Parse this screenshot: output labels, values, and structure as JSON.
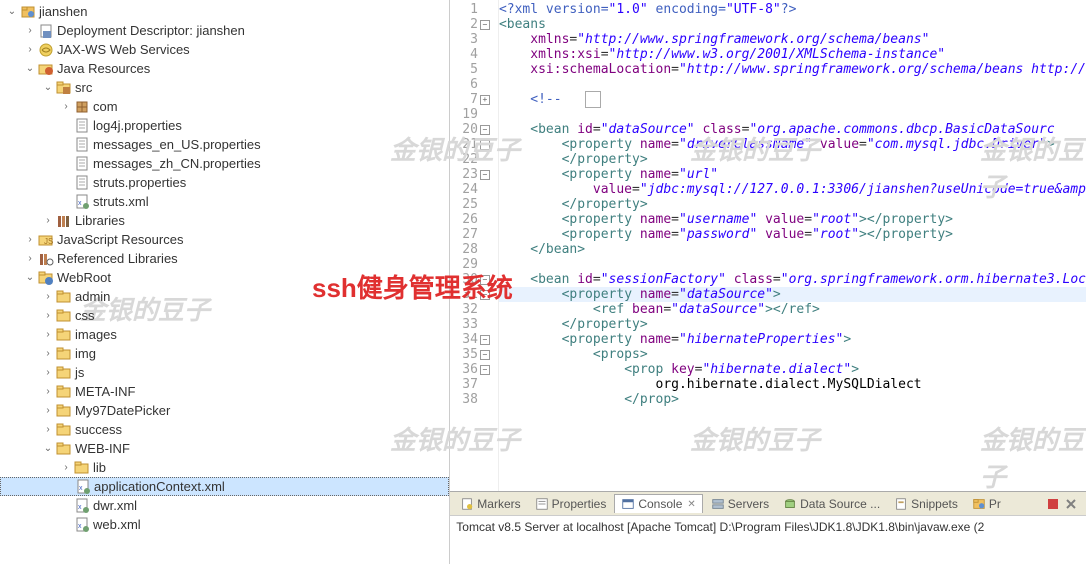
{
  "overlay_title": "ssh健身管理系统",
  "watermarks": [
    "金银的豆子",
    "金银的豆子",
    "金银的豆子",
    "金银的豆子",
    "金银的豆子",
    "金银的豆子",
    "金银的豆子"
  ],
  "tree": [
    {
      "depth": 0,
      "twisty": "down",
      "icon": "project",
      "label": "jianshen"
    },
    {
      "depth": 1,
      "twisty": "right",
      "icon": "dd",
      "label": "Deployment Descriptor: jianshen"
    },
    {
      "depth": 1,
      "twisty": "right",
      "icon": "jaxws",
      "label": "JAX-WS Web Services"
    },
    {
      "depth": 1,
      "twisty": "down",
      "icon": "javares",
      "label": "Java Resources"
    },
    {
      "depth": 2,
      "twisty": "down",
      "icon": "srcfolder",
      "label": "src"
    },
    {
      "depth": 3,
      "twisty": "right",
      "icon": "package",
      "label": "com"
    },
    {
      "depth": 3,
      "twisty": "",
      "icon": "file",
      "label": "log4j.properties"
    },
    {
      "depth": 3,
      "twisty": "",
      "icon": "file",
      "label": "messages_en_US.properties"
    },
    {
      "depth": 3,
      "twisty": "",
      "icon": "file",
      "label": "messages_zh_CN.properties"
    },
    {
      "depth": 3,
      "twisty": "",
      "icon": "file",
      "label": "struts.properties"
    },
    {
      "depth": 3,
      "twisty": "",
      "icon": "xml",
      "label": "struts.xml"
    },
    {
      "depth": 2,
      "twisty": "right",
      "icon": "lib",
      "label": "Libraries"
    },
    {
      "depth": 1,
      "twisty": "right",
      "icon": "jsres",
      "label": "JavaScript Resources"
    },
    {
      "depth": 1,
      "twisty": "right",
      "icon": "reflib",
      "label": "Referenced Libraries"
    },
    {
      "depth": 1,
      "twisty": "down",
      "icon": "webfolder",
      "label": "WebRoot"
    },
    {
      "depth": 2,
      "twisty": "right",
      "icon": "folder",
      "label": "admin"
    },
    {
      "depth": 2,
      "twisty": "right",
      "icon": "folder",
      "label": "css"
    },
    {
      "depth": 2,
      "twisty": "right",
      "icon": "folder",
      "label": "images"
    },
    {
      "depth": 2,
      "twisty": "right",
      "icon": "folder",
      "label": "img"
    },
    {
      "depth": 2,
      "twisty": "right",
      "icon": "folder",
      "label": "js"
    },
    {
      "depth": 2,
      "twisty": "right",
      "icon": "folder",
      "label": "META-INF"
    },
    {
      "depth": 2,
      "twisty": "right",
      "icon": "folder",
      "label": "My97DatePicker"
    },
    {
      "depth": 2,
      "twisty": "right",
      "icon": "folder",
      "label": "success"
    },
    {
      "depth": 2,
      "twisty": "down",
      "icon": "folder",
      "label": "WEB-INF"
    },
    {
      "depth": 3,
      "twisty": "right",
      "icon": "folder",
      "label": "lib"
    },
    {
      "depth": 3,
      "twisty": "",
      "icon": "xml",
      "label": "applicationContext.xml",
      "selected": true
    },
    {
      "depth": 3,
      "twisty": "",
      "icon": "xml",
      "label": "dwr.xml"
    },
    {
      "depth": 3,
      "twisty": "",
      "icon": "xml",
      "label": "web.xml"
    }
  ],
  "code": {
    "lines": [
      {
        "n": 1,
        "fold": "",
        "html": "<span class='c-comment'>&lt;?xml version=</span><span class='c-str'>\"1.0\"</span><span class='c-comment'> encoding=</span><span class='c-str'>\"UTF-8\"</span><span class='c-comment'>?&gt;</span>"
      },
      {
        "n": 2,
        "fold": "-",
        "html": "<span class='c-tag'>&lt;beans</span>"
      },
      {
        "n": 3,
        "fold": "",
        "html": "    <span class='c-attr'>xmlns</span>=<span class='c-val'>\"http://www.springframework.org/schema/beans\"</span>"
      },
      {
        "n": 4,
        "fold": "",
        "html": "    <span class='c-attr'>xmlns:xsi</span>=<span class='c-val'>\"http://www.w3.org/2001/XMLSchema-instance\"</span>"
      },
      {
        "n": 5,
        "fold": "",
        "html": "    <span class='c-attr'>xsi:schemaLocation</span>=<span class='c-val'>\"http://www.springframework.org/schema/beans http://</span>"
      },
      {
        "n": 6,
        "fold": "",
        "html": ""
      },
      {
        "n": 7,
        "fold": "+",
        "html": "    <span class='c-comment'>&lt;!--</span>   <span style='border:1px solid #aaa;padding:0 3px;'>&nbsp;</span>"
      },
      {
        "n": 19,
        "fold": "",
        "html": ""
      },
      {
        "n": 20,
        "fold": "-",
        "html": "    <span class='c-tag'>&lt;bean</span> <span class='c-attr'>id</span>=<span class='c-val'>\"dataSource\"</span> <span class='c-attr'>class</span>=<span class='c-val'>\"org.apache.commons.dbcp.BasicDataSourc</span>"
      },
      {
        "n": 21,
        "fold": "-",
        "html": "        <span class='c-tag'>&lt;property</span> <span class='c-attr'>name</span>=<span class='c-val'>\"driverClassName\"</span> <span class='c-attr'>value</span>=<span class='c-val'>\"com.mysql.jdbc.Driver\"</span><span class='c-tag'>&gt;</span>"
      },
      {
        "n": 22,
        "fold": "",
        "html": "        <span class='c-tag'>&lt;/property&gt;</span>"
      },
      {
        "n": 23,
        "fold": "-",
        "html": "        <span class='c-tag'>&lt;property</span> <span class='c-attr'>name</span>=<span class='c-val'>\"url\"</span>"
      },
      {
        "n": 24,
        "fold": "",
        "html": "            <span class='c-attr'>value</span>=<span class='c-val'>\"jdbc:mysql://127.0.0.1:3306/jianshen?useUnicode=true&amp;amp</span>"
      },
      {
        "n": 25,
        "fold": "",
        "html": "        <span class='c-tag'>&lt;/property&gt;</span>"
      },
      {
        "n": 26,
        "fold": "",
        "html": "        <span class='c-tag'>&lt;property</span> <span class='c-attr'>name</span>=<span class='c-val'>\"username\"</span> <span class='c-attr'>value</span>=<span class='c-val'>\"root\"</span><span class='c-tag'>&gt;&lt;/property&gt;</span>"
      },
      {
        "n": 27,
        "fold": "",
        "html": "        <span class='c-tag'>&lt;property</span> <span class='c-attr'>name</span>=<span class='c-val'>\"password\"</span> <span class='c-attr'>value</span>=<span class='c-val'>\"root\"</span><span class='c-tag'>&gt;&lt;/property&gt;</span>"
      },
      {
        "n": 28,
        "fold": "",
        "html": "    <span class='c-tag'>&lt;/bean&gt;</span>"
      },
      {
        "n": 29,
        "fold": "",
        "html": ""
      },
      {
        "n": 30,
        "fold": "-",
        "html": "    <span class='c-tag'>&lt;bean</span> <span class='c-attr'>id</span>=<span class='c-val'>\"sessionFactory\"</span> <span class='c-attr'>class</span>=<span class='c-val'>\"org.springframework.orm.hibernate3.Loc</span>"
      },
      {
        "n": 31,
        "fold": "-",
        "hl": true,
        "html": "        <span class='c-tag'>&lt;property</span> <span class='c-attr'>name</span>=<span class='c-val'>\"dataSource\"</span><span class='c-tag'>&gt;</span>"
      },
      {
        "n": 32,
        "fold": "",
        "html": "            <span class='c-tag'>&lt;ref</span> <span class='c-attr'>bean</span>=<span class='c-val'>\"dataSource\"</span><span class='c-tag'>&gt;&lt;/ref&gt;</span>"
      },
      {
        "n": 33,
        "fold": "",
        "html": "        <span class='c-tag'>&lt;/property&gt;</span>"
      },
      {
        "n": 34,
        "fold": "-",
        "html": "        <span class='c-tag'>&lt;property</span> <span class='c-attr'>name</span>=<span class='c-val'>\"hibernateProperties\"</span><span class='c-tag'>&gt;</span>"
      },
      {
        "n": 35,
        "fold": "-",
        "html": "            <span class='c-tag'>&lt;props&gt;</span>"
      },
      {
        "n": 36,
        "fold": "-",
        "html": "                <span class='c-tag'>&lt;prop</span> <span class='c-attr'>key</span>=<span class='c-val'>\"hibernate.dialect\"</span><span class='c-tag'>&gt;</span>"
      },
      {
        "n": 37,
        "fold": "",
        "html": "                    <span class='c-text'>org.hibernate.dialect.MySQLDialect</span>"
      },
      {
        "n": 38,
        "fold": "",
        "html": "                <span class='c-tag'>&lt;/prop&gt;</span>"
      }
    ]
  },
  "bottom_tabs": [
    {
      "icon": "markers",
      "label": "Markers"
    },
    {
      "icon": "props",
      "label": "Properties"
    },
    {
      "icon": "console",
      "label": "Console",
      "active": true,
      "close": true
    },
    {
      "icon": "servers",
      "label": "Servers"
    },
    {
      "icon": "datasource",
      "label": "Data Source ..."
    },
    {
      "icon": "snippets",
      "label": "Snippets"
    },
    {
      "icon": "project",
      "label": "Pr"
    }
  ],
  "console_text": "Tomcat v8.5 Server at localhost [Apache Tomcat] D:\\Program Files\\JDK1.8\\JDK1.8\\bin\\javaw.exe (2"
}
